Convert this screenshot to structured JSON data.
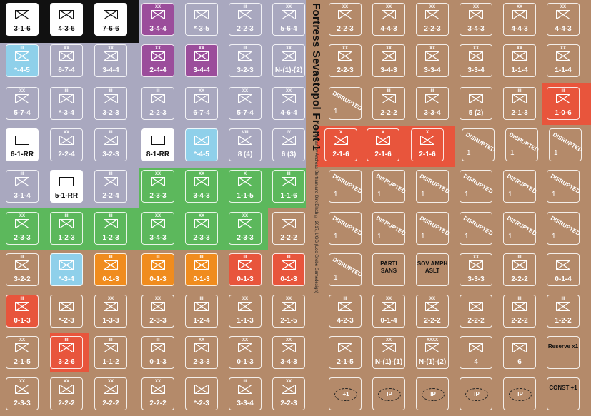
{
  "title": "Fortress Sevastopol  Front 1",
  "credits": "Counter art by Andreas Bertram and Dirk Blech   © 2017, UGG (Udo Grebe Gamedesign)",
  "colors": {
    "grey": "#a9a8bf",
    "green": "#5cb85c",
    "brown": "#b48a6a",
    "black": "#111111",
    "red": "#e8553c",
    "orange": "#f08c1e",
    "purple": "#9b4d9b",
    "skyblue": "#8fd0ea"
  },
  "counters": [
    {
      "label": "3-1-6",
      "style": "dark-pict"
    },
    {
      "label": "4-3-6",
      "style": "dark"
    },
    {
      "label": "7-6-6",
      "style": "dark-pict"
    },
    {
      "label": "3-4-4",
      "size": "XX",
      "color": "purple"
    },
    {
      "label": "*-3-5",
      "size": "",
      "color": "grey"
    },
    {
      "label": "2-2-3",
      "size": "III",
      "color": "grey"
    },
    {
      "label": "5-6-4",
      "size": "XX",
      "color": "grey"
    },
    {
      "label": "2-2-3",
      "size": "XX",
      "color": "brown"
    },
    {
      "label": "4-4-3",
      "size": "XX",
      "color": "brown"
    },
    {
      "label": "2-2-3",
      "size": "XX",
      "color": "brown"
    },
    {
      "label": "3-4-3",
      "size": "XX",
      "color": "brown"
    },
    {
      "label": "4-4-3",
      "size": "XX",
      "color": "brown"
    },
    {
      "label": "4-4-3",
      "size": "XX",
      "color": "brown"
    },
    {
      "label": "*-4-5",
      "size": "III",
      "color": "skyblue"
    },
    {
      "label": "6-7-4",
      "size": "XX",
      "color": "grey"
    },
    {
      "label": "3-4-4",
      "size": "XX",
      "color": "grey"
    },
    {
      "label": "2-4-4",
      "size": "XX",
      "color": "purple"
    },
    {
      "label": "3-4-4",
      "size": "XX",
      "color": "purple"
    },
    {
      "label": "3-2-3",
      "size": "III",
      "color": "grey"
    },
    {
      "label": "N-(1)-(2)",
      "size": "XX",
      "color": "grey"
    },
    {
      "label": "2-2-3",
      "size": "XX",
      "color": "brown"
    },
    {
      "label": "3-4-3",
      "size": "XX",
      "color": "brown"
    },
    {
      "label": "3-3-4",
      "size": "XX",
      "color": "brown"
    },
    {
      "label": "3-3-4",
      "size": "XX",
      "color": "brown"
    },
    {
      "label": "1-1-4",
      "size": "XX",
      "color": "brown"
    },
    {
      "label": "1-1-4",
      "size": "XX",
      "color": "brown"
    },
    {
      "label": "5-7-4",
      "size": "XX",
      "color": "grey"
    },
    {
      "label": "*-3-4",
      "size": "III",
      "color": "grey"
    },
    {
      "label": "3-2-3",
      "size": "III",
      "color": "grey"
    },
    {
      "label": "2-2-3",
      "size": "III",
      "color": "grey"
    },
    {
      "label": "6-7-4",
      "size": "XX",
      "color": "grey"
    },
    {
      "label": "5-7-4",
      "size": "XX",
      "color": "grey"
    },
    {
      "label": "4-6-4",
      "size": "XX",
      "color": "grey"
    },
    {
      "label": "DISRUPTED",
      "num": "1",
      "style": "dis"
    },
    {
      "label": "2-2-2",
      "size": "III",
      "color": "brown"
    },
    {
      "label": "3-3-4",
      "size": "III",
      "color": "brown"
    },
    {
      "label": "5 (2)",
      "size": "",
      "color": "brown"
    },
    {
      "label": "2-1-3",
      "size": "III",
      "color": "brown"
    },
    {
      "label": "1-0-6",
      "size": "III",
      "color": "red"
    },
    {
      "label": "6-1-RR",
      "size": "",
      "color": "grey-white"
    },
    {
      "label": "2-2-4",
      "size": "XX",
      "color": "grey"
    },
    {
      "label": "3-2-3",
      "size": "III",
      "color": "grey"
    },
    {
      "label": "8-1-RR",
      "size": "",
      "color": "grey-white"
    },
    {
      "label": "*-4-5",
      "size": "",
      "color": "skyblue"
    },
    {
      "label": "8 (4)",
      "size": "VIII",
      "color": "grey"
    },
    {
      "label": "6 (3)",
      "size": "IV",
      "color": "grey"
    },
    {
      "label": "2-1-6",
      "size": "X",
      "color": "red"
    },
    {
      "label": "2-1-6",
      "size": "X",
      "color": "red"
    },
    {
      "label": "2-1-6",
      "size": "X",
      "color": "red"
    },
    {
      "label": "DISRUPTED",
      "num": "1",
      "style": "dis"
    },
    {
      "label": "DISRUPTED",
      "num": "1",
      "style": "dis"
    },
    {
      "label": "DISRUPTED",
      "num": "1",
      "style": "dis"
    },
    {
      "label": "3-1-4",
      "size": "III",
      "color": "grey"
    },
    {
      "label": "5-1-RR",
      "size": "",
      "color": "grey-white"
    },
    {
      "label": "2-2-4",
      "size": "III",
      "color": "grey"
    },
    {
      "label": "2-3-3",
      "size": "XX",
      "color": "green"
    },
    {
      "label": "3-4-3",
      "size": "XX",
      "color": "green"
    },
    {
      "label": "1-1-5",
      "size": "X",
      "color": "green"
    },
    {
      "label": "1-1-6",
      "size": "III",
      "color": "green"
    },
    {
      "label": "DISRUPTED",
      "num": "1",
      "style": "dis"
    },
    {
      "label": "DISRUPTED",
      "num": "1",
      "style": "dis"
    },
    {
      "label": "DISRUPTED",
      "num": "1",
      "style": "dis"
    },
    {
      "label": "DISRUPTED",
      "num": "1",
      "style": "dis"
    },
    {
      "label": "DISRUPTED",
      "num": "1",
      "style": "dis"
    },
    {
      "label": "DISRUPTED",
      "num": "1",
      "style": "dis"
    },
    {
      "label": "2-3-3",
      "size": "XX",
      "color": "green"
    },
    {
      "label": "1-2-3",
      "size": "III",
      "color": "green"
    },
    {
      "label": "1-2-3",
      "size": "III",
      "color": "green"
    },
    {
      "label": "3-4-3",
      "size": "XX",
      "color": "green"
    },
    {
      "label": "2-3-3",
      "size": "XX",
      "color": "green"
    },
    {
      "label": "2-3-3",
      "size": "XX",
      "color": "green"
    },
    {
      "label": "2-2-2",
      "size": "",
      "color": "brown"
    },
    {
      "label": "DISRUPTED",
      "num": "1",
      "style": "dis"
    },
    {
      "label": "DISRUPTED",
      "num": "1",
      "style": "dis"
    },
    {
      "label": "DISRUPTED",
      "num": "1",
      "style": "dis"
    },
    {
      "label": "DISRUPTED",
      "num": "1",
      "style": "dis"
    },
    {
      "label": "DISRUPTED",
      "num": "1",
      "style": "dis"
    },
    {
      "label": "DISRUPTED",
      "num": "1",
      "style": "dis"
    },
    {
      "label": "3-2-2",
      "size": "III",
      "color": "brown"
    },
    {
      "label": "*-3-4",
      "size": "",
      "color": "skyblue"
    },
    {
      "label": "0-1-3",
      "size": "III",
      "color": "orange"
    },
    {
      "label": "0-1-3",
      "size": "III",
      "color": "orange"
    },
    {
      "label": "0-1-3",
      "size": "III",
      "color": "orange"
    },
    {
      "label": "0-1-3",
      "size": "III",
      "color": "red"
    },
    {
      "label": "0-1-3",
      "size": "III",
      "color": "red"
    },
    {
      "label": "DISRUPTED",
      "num": "1",
      "style": "dis"
    },
    {
      "label": "PARTI SANS",
      "style": "txt"
    },
    {
      "label": "SOV AMPH ASLT",
      "style": "txt"
    },
    {
      "label": "3-3-3",
      "size": "XX",
      "color": "brown"
    },
    {
      "label": "2-2-2",
      "size": "III",
      "color": "brown"
    },
    {
      "label": "0-1-4",
      "size": "",
      "color": "brown"
    },
    {
      "label": "0-1-3",
      "size": "III",
      "color": "red"
    },
    {
      "label": "*-2-3",
      "size": "",
      "color": "brown"
    },
    {
      "label": "1-3-3",
      "size": "XX",
      "color": "brown"
    },
    {
      "label": "2-3-3",
      "size": "XX",
      "color": "brown"
    },
    {
      "label": "1-2-4",
      "size": "III",
      "color": "brown"
    },
    {
      "label": "1-1-3",
      "size": "XX",
      "color": "brown"
    },
    {
      "label": "2-1-5",
      "size": "XX",
      "color": "brown"
    },
    {
      "label": "4-2-3",
      "size": "III",
      "color": "brown"
    },
    {
      "label": "0-1-4",
      "size": "XX",
      "color": "brown"
    },
    {
      "label": "2-2-2",
      "size": "XX",
      "color": "brown"
    },
    {
      "label": "2-2-2",
      "size": "",
      "color": "brown"
    },
    {
      "label": "2-2-2",
      "size": "III",
      "color": "brown"
    },
    {
      "label": "1-2-2",
      "size": "III",
      "color": "brown"
    },
    {
      "label": "2-1-5",
      "size": "XX",
      "color": "brown"
    },
    {
      "label": "3-2-6",
      "size": "III",
      "color": "red"
    },
    {
      "label": "1-1-2",
      "size": "III",
      "color": "brown"
    },
    {
      "label": "0-1-3",
      "size": "III",
      "color": "brown"
    },
    {
      "label": "2-3-3",
      "size": "XX",
      "color": "brown"
    },
    {
      "label": "0-1-3",
      "size": "XX",
      "color": "brown"
    },
    {
      "label": "3-4-3",
      "size": "XX",
      "color": "brown"
    },
    {
      "label": "2-1-5",
      "size": "",
      "color": "brown"
    },
    {
      "label": "N-(1)-(1)",
      "size": "XX",
      "color": "brown"
    },
    {
      "label": "N-(1)-(2)",
      "size": "XXXX",
      "color": "brown"
    },
    {
      "label": "4",
      "size": "",
      "color": "brown"
    },
    {
      "label": "6",
      "size": "",
      "color": "brown"
    },
    {
      "label": "Reserve x1",
      "style": "txt2"
    },
    {
      "label": "2-3-3",
      "size": "XX",
      "color": "brown"
    },
    {
      "label": "2-2-2",
      "size": "XX",
      "color": "brown"
    },
    {
      "label": "2-2-2",
      "size": "XX",
      "color": "brown"
    },
    {
      "label": "2-2-2",
      "size": "XX",
      "color": "brown"
    },
    {
      "label": "*-2-3",
      "size": "",
      "color": "brown"
    },
    {
      "label": "3-3-4",
      "size": "III",
      "color": "brown"
    },
    {
      "label": "2-2-3",
      "size": "XX",
      "color": "brown"
    },
    {
      "label": "+1",
      "style": "icon"
    },
    {
      "label": "IP",
      "style": "ip"
    },
    {
      "label": "IP",
      "style": "ip"
    },
    {
      "label": "IP",
      "style": "ip"
    },
    {
      "label": "IP",
      "style": "ip"
    },
    {
      "label": "CONST +1",
      "style": "txt"
    }
  ]
}
